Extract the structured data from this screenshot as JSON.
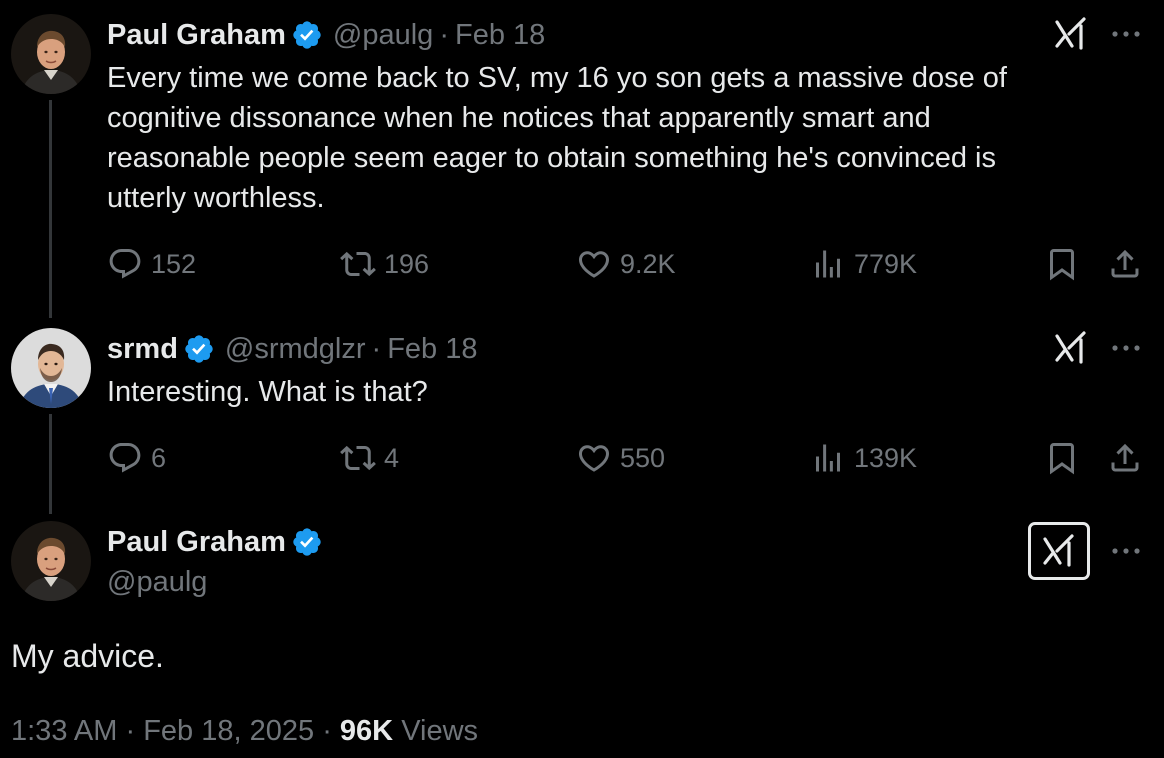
{
  "tweets": [
    {
      "name": "Paul Graham",
      "handle": "@paulg",
      "separator": "·",
      "date": "Feb 18",
      "lines": [
        "Every time we come back to SV, my 16 yo son gets a massive dose of",
        "cognitive dissonance when he notices that apparently smart and",
        "reasonable people seem eager to obtain something he's convinced is",
        "utterly worthless."
      ],
      "replies": "152",
      "reposts": "196",
      "likes": "9.2K",
      "views": "779K"
    },
    {
      "name": "srmd",
      "handle": "@srmdglzr",
      "separator": "·",
      "date": "Feb 18",
      "lines": [
        "Interesting. What is that?"
      ],
      "replies": "6",
      "reposts": "4",
      "likes": "550",
      "views": "139K"
    }
  ],
  "main_tweet": {
    "name": "Paul Graham",
    "handle": "@paulg",
    "text": "My advice.",
    "time": "1:33 AM",
    "separator": "·",
    "date": "Feb 18, 2025",
    "separator2": "·",
    "views_count": "96K",
    "views_label": "Views"
  },
  "colors": {
    "background": "#000000",
    "text": "#e7e9ea",
    "muted": "#71767b",
    "verified": "#1d9bf0",
    "thread_line": "#333639"
  },
  "icons": {
    "verified": "verified-badge-icon",
    "grok": "grok-icon",
    "more": "more-icon",
    "reply": "reply-icon",
    "repost": "repost-icon",
    "like": "heart-icon",
    "views": "views-icon",
    "bookmark": "bookmark-icon",
    "share": "share-icon"
  }
}
